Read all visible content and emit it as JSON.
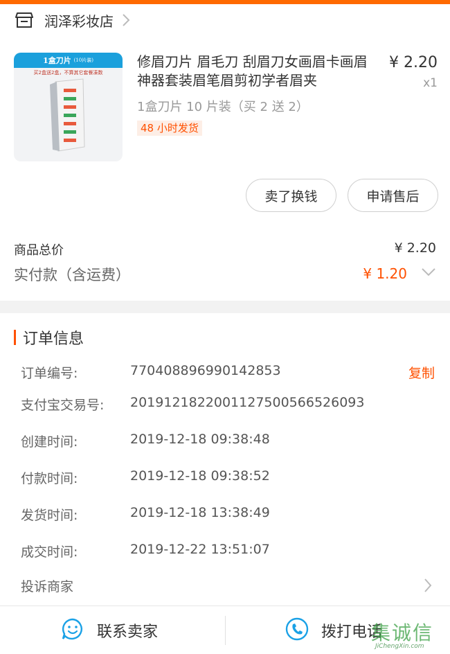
{
  "store": {
    "name": "润泽彩妆店",
    "icon": "store-icon"
  },
  "product": {
    "title": "修眉刀片 眉毛刀 刮眉刀女画眉卡画眉神器套装眉笔眉剪初学者眉夹",
    "price": "¥ 2.20",
    "quantity": "x1",
    "spec": "1盒刀片 10 片装（买 2 送 2）",
    "tag": "48 小时发货",
    "thumbnail": {
      "banner": "1盒刀片",
      "banner_note": "(10片装)",
      "subtitle": "买2盒送2盒，不算其它套餐凑数"
    }
  },
  "actions": {
    "sell_label": "卖了换钱",
    "after_sale_label": "申请售后"
  },
  "summary": {
    "total_label": "商品总价",
    "total_value": "¥ 2.20",
    "paid_label": "实付款（含运费）",
    "paid_value": "¥ 1.20"
  },
  "order_info": {
    "title": "订单信息",
    "rows": [
      {
        "label": "订单编号:",
        "value": "770408896990142853",
        "action": "复制"
      },
      {
        "label": "支付宝交易号:",
        "value": "2019121822001127500566526093"
      },
      {
        "label": "创建时间:",
        "value": "2019-12-18 09:38:48"
      },
      {
        "label": "付款时间:",
        "value": "2019-12-18 09:38:52"
      },
      {
        "label": "发货时间:",
        "value": "2019-12-18 13:38:49"
      },
      {
        "label": "成交时间:",
        "value": "2019-12-22 13:51:07"
      }
    ],
    "complain_label": "投诉商家"
  },
  "bottom_bar": {
    "contact_label": "联系卖家",
    "call_label": "拨打电话"
  },
  "watermark": {
    "text": "集诚信",
    "url": "JiChengXin.com"
  },
  "colors": {
    "accent": "#ff5000",
    "topbar": "#ff6a00",
    "icon_blue": "#1aa1e6"
  }
}
